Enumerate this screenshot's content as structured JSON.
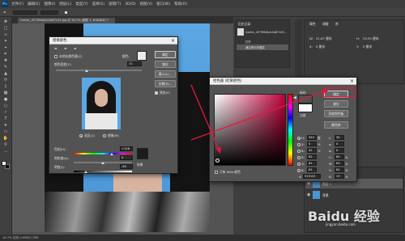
{
  "app": {
    "logo": "Ps",
    "menu": [
      "文件(F)",
      "编辑(E)",
      "图像(I)",
      "图层(L)",
      "类型(Y)",
      "选择(S)",
      "滤镜(T)",
      "3D(D)",
      "视图(V)",
      "窗口(W)",
      "帮助(H)"
    ],
    "doc_tab": "Cache_-67769d4cb1b67145.jpg @ 16.7% (图层 1, RGB/8#) *",
    "status": "16.7%   文档:1.85M/3.70M"
  },
  "history_panel": {
    "title": "历史记录",
    "items": [
      "Cache_-67769d4cb1b67145...",
      "打开",
      "通过拷贝的图层"
    ]
  },
  "properties_panel": {
    "tabs": [
      "属性",
      "调整",
      "库"
    ],
    "fields": [
      {
        "label": "W:",
        "value": "21.87 厘米"
      },
      {
        "label": "H:",
        "value": "29.55 厘米"
      },
      {
        "label": "X:",
        "value": "0 厘米"
      },
      {
        "label": "Y:",
        "value": "0 厘米"
      }
    ]
  },
  "layers_panel": {
    "items": [
      {
        "name": "图层 1"
      },
      {
        "name": "背景"
      }
    ]
  },
  "replace_color_dialog": {
    "title": "替换颜色",
    "localized_clusters": "本地化颜色簇(Z)",
    "color_label": "颜色:",
    "fuzziness_label": "颜色容差(F):",
    "fuzziness_value": "72",
    "buttons": {
      "ok": "确定",
      "cancel": "复位",
      "load": "载入(L)...",
      "save": "存储(S)..."
    },
    "preview_label": "预览(P)",
    "mode_selection": "选区(C)",
    "mode_image": "图像(M)",
    "hue_label": "色相(H):",
    "hue_value": "+126",
    "saturation_label": "饱和度(A):",
    "saturation_value": "0",
    "lightness_label": "明度(I):",
    "lightness_value": "-60",
    "result_label": "结果"
  },
  "color_picker_dialog": {
    "title": "拾色器 (结果颜色)",
    "new_label": "新的",
    "current_label": "当前",
    "buttons": {
      "ok": "确定",
      "reset": "复位",
      "add_swatch": "添加到色板",
      "libraries": "颜色库"
    },
    "web_only": "只有 Web 颜色",
    "fields": [
      {
        "label": "H:",
        "value": "345",
        "unit": "度"
      },
      {
        "label": "S:",
        "value": "0",
        "unit": "%"
      },
      {
        "label": "B:",
        "value": "32",
        "unit": "%"
      },
      {
        "label": "R:",
        "value": "82",
        "unit": ""
      },
      {
        "label": "G:",
        "value": "81",
        "unit": ""
      },
      {
        "label": "B:",
        "value": "81",
        "unit": ""
      },
      {
        "label": "L:",
        "value": "34",
        "unit": ""
      },
      {
        "label": "a:",
        "value": "0",
        "unit": ""
      },
      {
        "label": "b:",
        "value": "0",
        "unit": ""
      },
      {
        "label": "C:",
        "value": "69",
        "unit": "%"
      },
      {
        "label": "M:",
        "value": "63",
        "unit": "%"
      },
      {
        "label": "Y:",
        "value": "62",
        "unit": "%"
      },
      {
        "label": "K:",
        "value": "13",
        "unit": "%"
      }
    ],
    "hex_label": "#",
    "hex_value": "515151"
  },
  "watermark": {
    "text": "Baidu 经验",
    "url": "jingyan.baidu.com"
  },
  "colors": {
    "annotation_arrow": "#e8173a",
    "bg_blue": "#5aa7e3",
    "result_swatch": "#1c1c1c"
  }
}
